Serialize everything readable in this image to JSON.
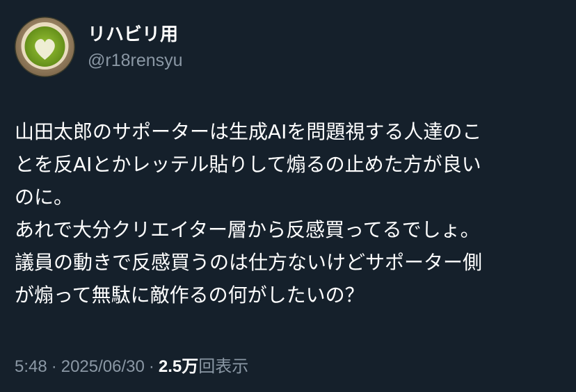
{
  "author": {
    "display_name": "リハビリ用",
    "handle": "@r18rensyu",
    "avatar_icon": "matcha-latte-heart-icon"
  },
  "post": {
    "lines": [
      "山田太郎のサポーターは生成AIを問題視する人達のこ",
      "とを反AIとかレッテル貼りして煽るの止めた方が良い",
      "のに。",
      "あれで大分クリエイター層から反感買ってるでしょ。",
      "議員の動きで反感買うのは仕方ないけどサポーター側",
      "が煽って無駄に敵作るの何がしたいの？"
    ]
  },
  "meta": {
    "time": "5:48",
    "separator": "·",
    "date": "2025/06/30",
    "views_count": "2.5万",
    "views_label": "回表示"
  },
  "colors": {
    "background": "#15202b",
    "primary_text": "#ffffff",
    "secondary_text": "#8b98a5"
  }
}
